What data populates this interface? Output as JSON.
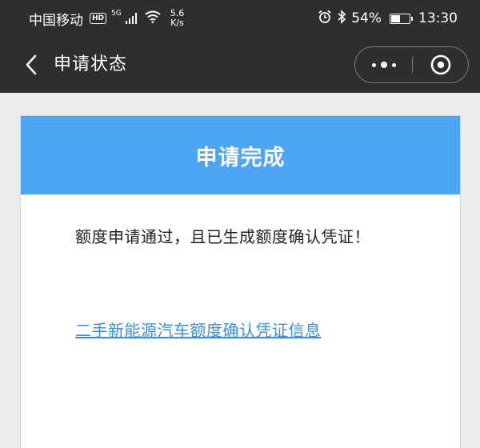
{
  "status_bar": {
    "carrier": "中国移动",
    "hd_badge": "HD",
    "network_type": "5G",
    "speed_value": "5.6",
    "speed_unit": "K/s",
    "battery_percent": "54%",
    "battery_level": 0.54,
    "time": "13:30"
  },
  "nav": {
    "title": "申请状态"
  },
  "card": {
    "header": "申请完成",
    "message": "额度申请通过，且已生成额度确认凭证！",
    "link_text": "二手新能源汽车额度确认凭证信息"
  },
  "colors": {
    "bar_background": "#2e2e2e",
    "header_blue": "#4da5f5",
    "link_blue": "#3b8ee6"
  }
}
